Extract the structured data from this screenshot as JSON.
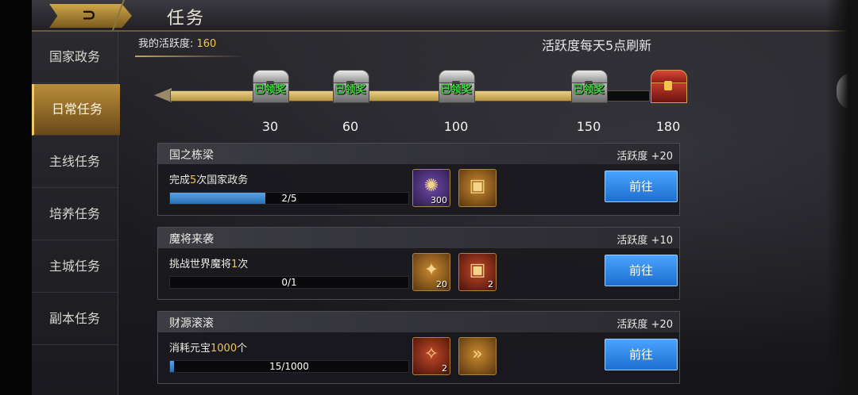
{
  "header": {
    "title": "任务",
    "back_icon": "back-arrow-icon"
  },
  "sidebar": {
    "items": [
      {
        "label": "国家政务",
        "active": false
      },
      {
        "label": "日常任务",
        "active": true
      },
      {
        "label": "主线任务",
        "active": false
      },
      {
        "label": "培养任务",
        "active": false
      },
      {
        "label": "主城任务",
        "active": false
      },
      {
        "label": "副本任务",
        "active": false
      }
    ]
  },
  "activity": {
    "label": "我的活跃度: ",
    "value": "160",
    "refresh_note": "活跃度每天5点刷新",
    "progress_fraction": 0.89,
    "milestones": [
      {
        "value": "30",
        "status": "已领奖"
      },
      {
        "value": "60",
        "status": "已领奖"
      },
      {
        "value": "100",
        "status": "已领奖"
      },
      {
        "value": "150",
        "status": "已领奖"
      },
      {
        "value": "180",
        "status": ""
      }
    ]
  },
  "tasks": [
    {
      "name": "国之栋梁",
      "points": "活跃度 +20",
      "desc_pre": "完成",
      "desc_hl": "5",
      "desc_post": "次国家政务",
      "progress_text": "2/5",
      "progress_fraction": 0.4,
      "rewards": [
        {
          "icon": "coin-icon",
          "count": "300"
        },
        {
          "icon": "treasure-chest-icon",
          "count": ""
        }
      ],
      "button": "前往"
    },
    {
      "name": "魔将来袭",
      "points": "活跃度 +10",
      "desc_pre": "挑战世界魔将",
      "desc_hl": "1",
      "desc_post": "次",
      "progress_text": "0/1",
      "progress_fraction": 0.0,
      "rewards": [
        {
          "icon": "crystal-icon",
          "count": "20"
        },
        {
          "icon": "treasure-chest-icon",
          "count": "2"
        }
      ],
      "button": "前往"
    },
    {
      "name": "财源滚滚",
      "points": "活跃度 +20",
      "desc_pre": "消耗元宝",
      "desc_hl": "1000",
      "desc_post": "个",
      "progress_text": "15/1000",
      "progress_fraction": 0.015,
      "rewards": [
        {
          "icon": "scroll-icon",
          "count": "2"
        },
        {
          "icon": "fast-forward-icon",
          "count": ""
        }
      ],
      "button": "前往"
    }
  ],
  "colors": {
    "accent": "#f3c64b",
    "button": "#2a86e8",
    "claimed": "#3fdc3f"
  }
}
